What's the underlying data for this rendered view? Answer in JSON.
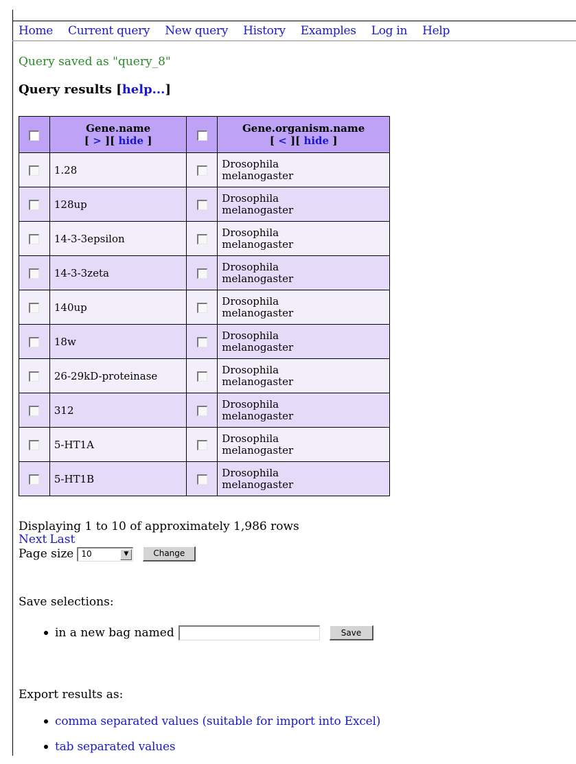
{
  "nav": {
    "items": [
      {
        "label": "Home"
      },
      {
        "label": "Current query"
      },
      {
        "label": "New query"
      },
      {
        "label": "History"
      },
      {
        "label": "Examples"
      },
      {
        "label": "Log in"
      },
      {
        "label": "Help"
      }
    ]
  },
  "status": {
    "message": "Query saved as \"query_8\""
  },
  "results": {
    "heading": "Query results",
    "help_open": "[",
    "help_label": "help...",
    "help_close": "]"
  },
  "table": {
    "columns": [
      {
        "name": "Gene.name",
        "bracket_open": "[",
        "move_label": ">",
        "mid": "][",
        "hide_label": "hide",
        "bracket_close": "]"
      },
      {
        "name": "Gene.organism.name",
        "bracket_open": "[",
        "move_label": "<",
        "mid": "][",
        "hide_label": "hide",
        "bracket_close": "]"
      }
    ],
    "rows": [
      {
        "gene": "1.28",
        "org_line1": "Drosophila",
        "org_line2": "melanogaster"
      },
      {
        "gene": "128up",
        "org_line1": "Drosophila",
        "org_line2": "melanogaster"
      },
      {
        "gene": "14-3-3epsilon",
        "org_line1": "Drosophila",
        "org_line2": "melanogaster"
      },
      {
        "gene": "14-3-3zeta",
        "org_line1": "Drosophila",
        "org_line2": "melanogaster"
      },
      {
        "gene": "140up",
        "org_line1": "Drosophila",
        "org_line2": "melanogaster"
      },
      {
        "gene": "18w",
        "org_line1": "Drosophila",
        "org_line2": "melanogaster"
      },
      {
        "gene": "26-29kD-proteinase",
        "org_line1": "Drosophila",
        "org_line2": "melanogaster"
      },
      {
        "gene": "312",
        "org_line1": "Drosophila",
        "org_line2": "melanogaster"
      },
      {
        "gene": "5-HT1A",
        "org_line1": "Drosophila",
        "org_line2": "melanogaster"
      },
      {
        "gene": "5-HT1B",
        "org_line1": "Drosophila",
        "org_line2": "melanogaster"
      }
    ]
  },
  "pager": {
    "summary": "Displaying 1 to 10 of approximately 1,986 rows",
    "next_label": "Next",
    "last_label": "Last",
    "page_size_label": "Page size",
    "page_size_value": "10",
    "change_label": "Change"
  },
  "save": {
    "heading": "Save selections:",
    "bag_label": "in a new bag named",
    "bag_value": "",
    "save_label": "Save"
  },
  "export": {
    "heading": "Export results as:",
    "csv_label": "comma separated values (suitable for import into Excel)",
    "tsv_label": "tab separated values"
  },
  "colors": {
    "link": "#1a1acc",
    "status_green": "#2a8a2a",
    "header_bg": "#bda2f5",
    "row_light": "#f3effa",
    "row_dark": "#e6daf9"
  }
}
